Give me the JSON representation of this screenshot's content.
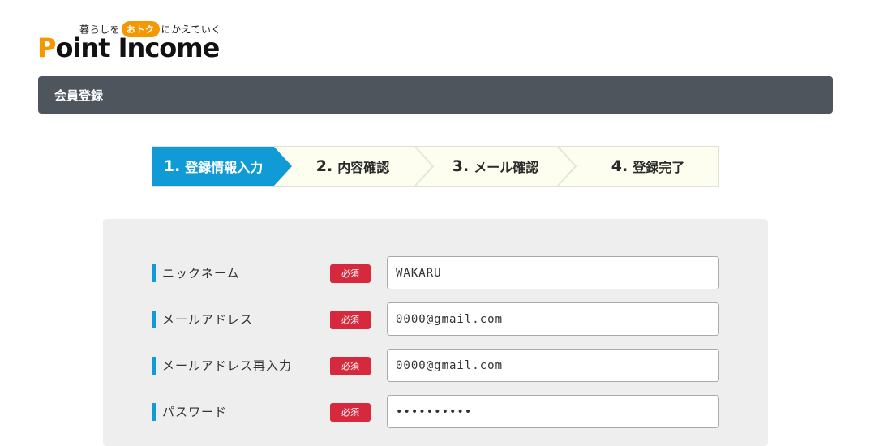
{
  "logo": {
    "tagline_pre": "暮らしを",
    "tagline_badge": "おトク",
    "tagline_post": "にかえていく",
    "name_first": "P",
    "name_rest": "oint Income",
    "accent": "#f39800"
  },
  "header": {
    "title": "会員登録",
    "bg": "#4f555c"
  },
  "steps": [
    {
      "num": "1.",
      "label": "登録情報入力",
      "active": true
    },
    {
      "num": "2.",
      "label": "内容確認",
      "active": false
    },
    {
      "num": "3.",
      "label": "メール確認",
      "active": false
    },
    {
      "num": "4.",
      "label": "登録完了",
      "active": false
    }
  ],
  "form": {
    "required_label": "必須",
    "fields": [
      {
        "label": "ニックネーム",
        "value": "WAKARU"
      },
      {
        "label": "メールアドレス",
        "value": "0000@gmail.com"
      },
      {
        "label": "メールアドレス再入力",
        "value": "0000@gmail.com"
      },
      {
        "label": "パスワード",
        "value": "••••••••••"
      }
    ]
  },
  "colors": {
    "step_active": "#109ad6",
    "required": "#d7293e",
    "step_bg": "#fdfdf0"
  }
}
